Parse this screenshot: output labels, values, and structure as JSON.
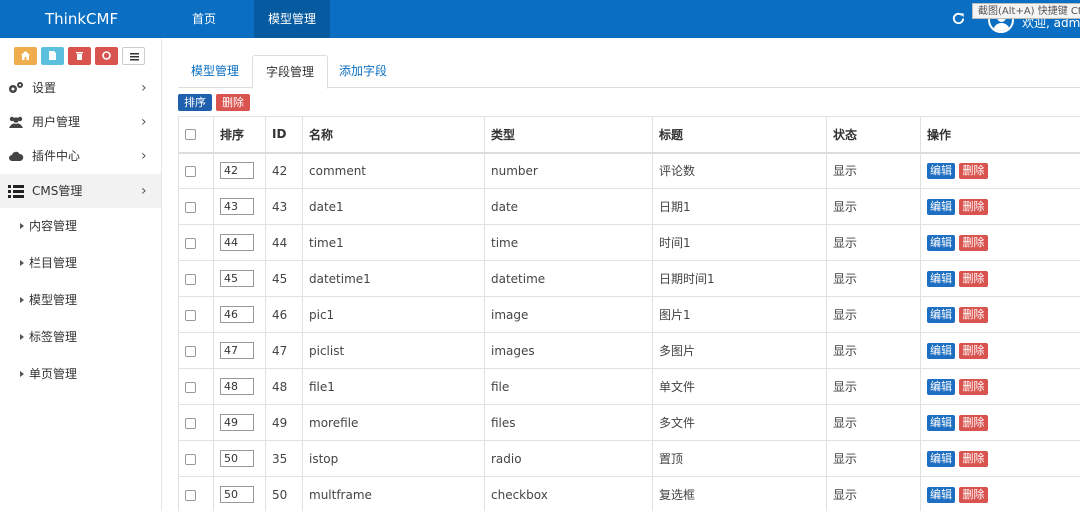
{
  "navbar": {
    "brand": "ThinkCMF",
    "items": [
      {
        "label": "首页"
      },
      {
        "label": "模型管理"
      }
    ],
    "tooltip": "截图(Alt+A) 快捷键 Ctrl+Shift",
    "welcome": "欢迎, admin"
  },
  "sidebar": {
    "menu": [
      {
        "label": "设置",
        "icon": "gears-icon"
      },
      {
        "label": "用户管理",
        "icon": "users-icon"
      },
      {
        "label": "插件中心",
        "icon": "cloud-icon"
      },
      {
        "label": "CMS管理",
        "icon": "list-icon"
      }
    ],
    "submenu": [
      {
        "label": "内容管理"
      },
      {
        "label": "栏目管理"
      },
      {
        "label": "模型管理"
      },
      {
        "label": "标签管理"
      },
      {
        "label": "单页管理"
      }
    ]
  },
  "tabs": [
    {
      "label": "模型管理"
    },
    {
      "label": "字段管理"
    },
    {
      "label": "添加字段"
    }
  ],
  "toolbar": {
    "sort_label": "排序",
    "delete_label": "删除"
  },
  "table": {
    "headers": {
      "order": "排序",
      "id": "ID",
      "name": "名称",
      "type": "类型",
      "title": "标题",
      "status": "状态",
      "actions": "操作"
    },
    "edit_label": "编辑",
    "delete_label": "删除",
    "rows": [
      {
        "order": "42",
        "id": "42",
        "name": "comment",
        "type": "number",
        "title": "评论数",
        "status": "显示"
      },
      {
        "order": "43",
        "id": "43",
        "name": "date1",
        "type": "date",
        "title": "日期1",
        "status": "显示"
      },
      {
        "order": "44",
        "id": "44",
        "name": "time1",
        "type": "time",
        "title": "时间1",
        "status": "显示"
      },
      {
        "order": "45",
        "id": "45",
        "name": "datetime1",
        "type": "datetime",
        "title": "日期时间1",
        "status": "显示"
      },
      {
        "order": "46",
        "id": "46",
        "name": "pic1",
        "type": "image",
        "title": "图片1",
        "status": "显示"
      },
      {
        "order": "47",
        "id": "47",
        "name": "piclist",
        "type": "images",
        "title": "多图片",
        "status": "显示"
      },
      {
        "order": "48",
        "id": "48",
        "name": "file1",
        "type": "file",
        "title": "单文件",
        "status": "显示"
      },
      {
        "order": "49",
        "id": "49",
        "name": "morefile",
        "type": "files",
        "title": "多文件",
        "status": "显示"
      },
      {
        "order": "50",
        "id": "35",
        "name": "istop",
        "type": "radio",
        "title": "置顶",
        "status": "显示"
      },
      {
        "order": "50",
        "id": "50",
        "name": "multframe",
        "type": "checkbox",
        "title": "复选框",
        "status": "显示"
      }
    ]
  }
}
